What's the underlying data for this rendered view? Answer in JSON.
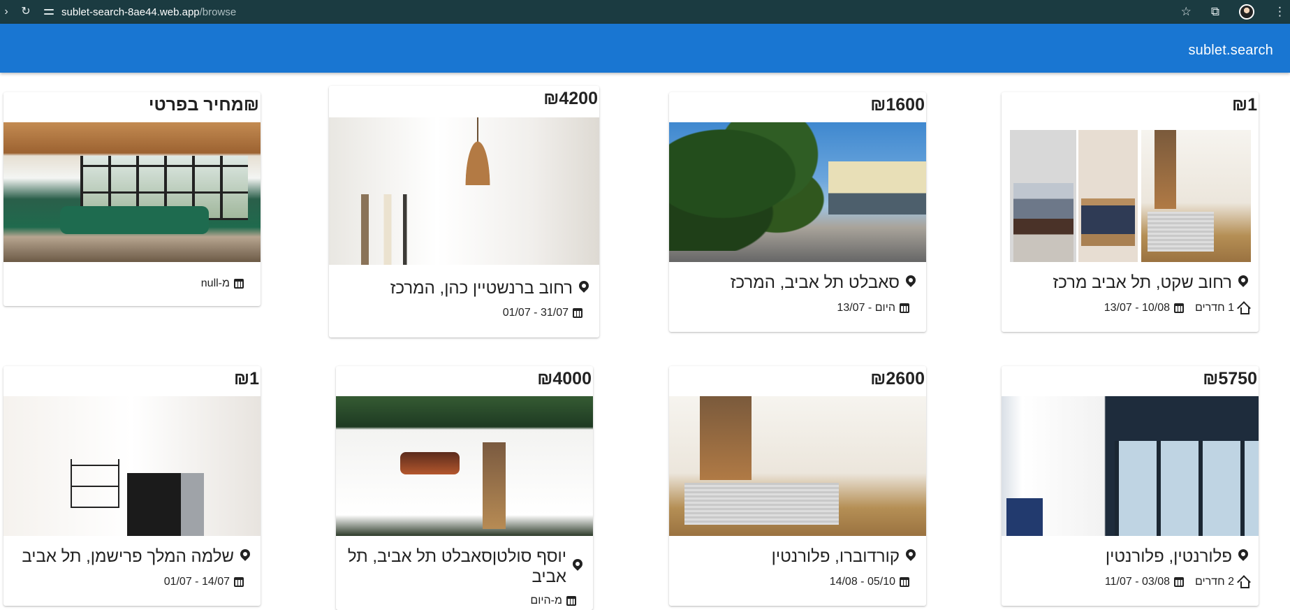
{
  "browser": {
    "url_host": "sublet-search-8ae44.web.app",
    "url_path": "/browse",
    "icons": [
      "reload-icon",
      "site-info-icon",
      "bookmark-star-icon",
      "extensions-icon",
      "profile-avatar",
      "menu-kebab-icon"
    ]
  },
  "app": {
    "brand": "sublet.search",
    "accent_color": "#1976d2"
  },
  "listings": [
    {
      "price": "₪1",
      "location": "רחוב שקט, תל אביב מרכז",
      "dates": "10/08 - 13/07",
      "rooms": "1 חדרים"
    },
    {
      "price": "₪1600",
      "location": "סאבלט תל אביב, המרכז",
      "dates": "היום - 13/07",
      "rooms": ""
    },
    {
      "price": "₪4200",
      "location": "רחוב ברנשטיין כהן, המרכז",
      "dates": "31/07 - 01/07",
      "rooms": ""
    },
    {
      "price": "₪מחיר בפרטי",
      "location": "",
      "dates": "מ-null",
      "rooms": ""
    },
    {
      "price": "₪5750",
      "location": "פלורנטין, פלורנטין",
      "dates": "03/08 - 11/07",
      "rooms": "2 חדרים"
    },
    {
      "price": "₪2600",
      "location": "קורדוברו, פלורנטין",
      "dates": "05/10 - 14/08",
      "rooms": ""
    },
    {
      "price": "₪4000",
      "location": "יוסף סולטןסאבלט תל אביב, תל אביב",
      "dates": "מ-היום",
      "rooms": ""
    },
    {
      "price": "₪1",
      "location": "שלמה המלך פרישמן, תל אביב",
      "dates": "14/07 - 01/07",
      "rooms": ""
    }
  ]
}
